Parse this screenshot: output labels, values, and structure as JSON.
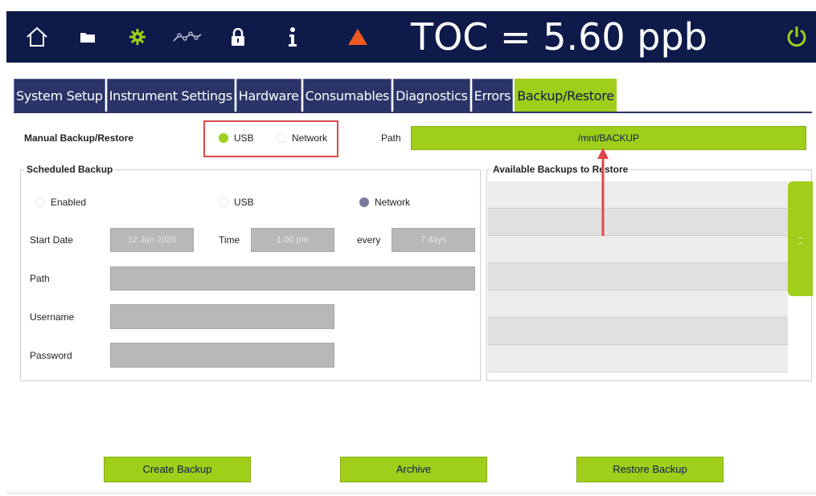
{
  "topbar": {
    "reading": "TOC = 5.60 ppb",
    "icons": [
      "home-icon",
      "folder-icon",
      "gear-icon",
      "trend-icon",
      "lock-icon",
      "info-icon",
      "warning-icon",
      "power-icon"
    ]
  },
  "tabs": [
    {
      "label": "System Setup",
      "active": false
    },
    {
      "label": "Instrument Settings",
      "active": false
    },
    {
      "label": "Hardware",
      "active": false
    },
    {
      "label": "Consumables",
      "active": false
    },
    {
      "label": "Diagnostics",
      "active": false
    },
    {
      "label": "Errors",
      "active": false
    },
    {
      "label": "Backup/Restore",
      "active": true
    }
  ],
  "manual": {
    "title": "Manual Backup/Restore",
    "usb_label": "USB",
    "network_label": "Network",
    "selected": "USB",
    "path_label": "Path",
    "path_value": "/mnt/BACKUP"
  },
  "scheduled": {
    "title": "Scheduled Backup",
    "enabled_label": "Enabled",
    "usb_label": "USB",
    "network_label": "Network",
    "selected": "Network",
    "start_date_label": "Start Date",
    "start_date_value": "12 Jun 2020",
    "time_label": "Time",
    "time_value": "1:00 pm",
    "every_label": "every",
    "every_value": "7 days",
    "path_label": "Path",
    "username_label": "Username",
    "password_label": "Password"
  },
  "restore": {
    "title": "Available Backups to Restore"
  },
  "buttons": {
    "create": "Create Backup",
    "archive": "Archive",
    "restore": "Restore Backup"
  },
  "colors": {
    "navy": "#0e1a4a",
    "accent": "#9fcf1a",
    "warning": "#f05a1e",
    "highlight": "#e04848"
  }
}
